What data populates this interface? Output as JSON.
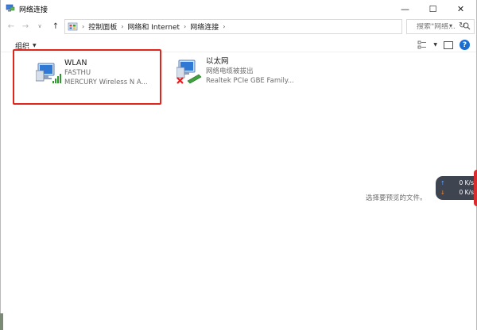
{
  "window": {
    "title": "网络连接",
    "controls": {
      "minimize": "—",
      "maximize": "☐",
      "close": "✕"
    }
  },
  "nav": {
    "back": "←",
    "forward": "→",
    "history": "∨",
    "up": "↑",
    "breadcrumbs": [
      "控制面板",
      "网络和 Internet",
      "网络连接"
    ],
    "search_placeholder": "搜索\"网络..."
  },
  "commandbar": {
    "organize_label": "组织"
  },
  "connections": [
    {
      "name": "WLAN",
      "status": "FASTHU",
      "device": "MERCURY Wireless N A..."
    },
    {
      "name": "以太网",
      "status": "网络电缆被拔出",
      "device": "Realtek PCIe GBE Family..."
    }
  ],
  "preview": {
    "text": "选择要预览的文件。"
  },
  "speed_widget": {
    "upload": "0 K/s",
    "download": "0 K/s"
  },
  "colors": {
    "highlight_border": "#e0261c",
    "help_blue": "#1a6fd1",
    "speed_bg": "#3f4451"
  }
}
